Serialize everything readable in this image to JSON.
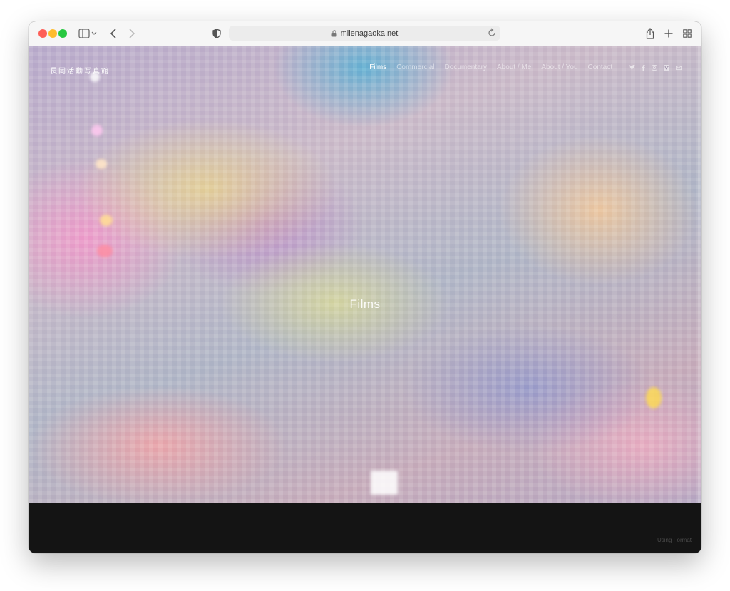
{
  "browser": {
    "address": "milenagaoka.net"
  },
  "site": {
    "logo_text": "長岡活動写真館",
    "nav": [
      {
        "label": "Films",
        "active": true
      },
      {
        "label": "Commercial",
        "active": false
      },
      {
        "label": "Documentary",
        "active": false
      },
      {
        "label": "About / Me",
        "active": false
      },
      {
        "label": "About / You",
        "active": false
      },
      {
        "label": "Contact",
        "active": false
      }
    ],
    "social_icons": [
      "twitter-icon",
      "facebook-icon",
      "instagram-icon",
      "vimeo-icon",
      "mail-icon"
    ],
    "hero_title": "Films",
    "footer_link": "Using Format"
  },
  "colors": {
    "toolbar_bg": "#f6f6f6",
    "footer_bg": "#141414",
    "nav_active": "#ffffff"
  }
}
